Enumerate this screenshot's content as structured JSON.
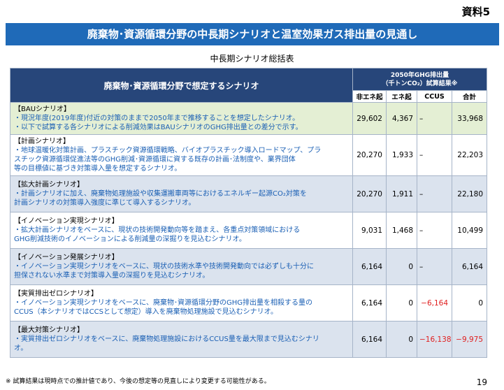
{
  "doc_label": "資料5",
  "title": "廃棄物･資源循環分野の中長期シナリオと温室効果ガス排出量の見通し",
  "subtitle": "中長期シナリオ総括表",
  "table": {
    "header_scenario": "廃棄物･資源循環分野で想定するシナリオ",
    "header_group_line1": "2050年GHG排出量",
    "header_group_line2": "（千トンCO₂）試算結果※",
    "columns": [
      "非エネ起",
      "エネ起",
      "CCUS",
      "合計"
    ],
    "rows": [
      {
        "name": "【BAUシナリオ】",
        "desc": [
          "・現況年度(2019年度)付近の対策のままで2050年まで推移することを想定したシナリオ。",
          "・以下で試算する各シナリオによる削減効果はBAUシナリオのGHG排出量との差分で示す。"
        ],
        "non_energy": "29,602",
        "energy": "4,367",
        "ccus": "–",
        "total": "33,968"
      },
      {
        "name": "【計画シナリオ】",
        "desc": [
          "・地球温暖化対策計画、プラスチック資源循環戦略、バイオプラスチック導入ロードマップ、プラ",
          "スチック資源循環促進法等のGHG削減･資源循環に資する既存の計画･法制度や、業界団体",
          "等の目標値に基づき対策導入量を想定するシナリオ。"
        ],
        "non_energy": "20,270",
        "energy": "1,933",
        "ccus": "–",
        "total": "22,203"
      },
      {
        "name": "【拡大計画シナリオ】",
        "desc": [
          "・計画シナリオに加え、廃棄物処理施設や収集運搬車両等におけるエネルギー起源CO₂対策を",
          "計画シナリオの対策導入強度に準じて導入するシナリオ。"
        ],
        "non_energy": "20,270",
        "energy": "1,911",
        "ccus": "–",
        "total": "22,180"
      },
      {
        "name": "【イノベーション実現シナリオ】",
        "desc": [
          "・拡大計画シナリオをベースに、現状の技術開発動向等を踏まえ、各重点対策領域における",
          "GHG削減技術のイノベーションによる削減量の深掘りを見込むシナリオ。"
        ],
        "non_energy": "9,031",
        "energy": "1,468",
        "ccus": "–",
        "total": "10,499"
      },
      {
        "name": "【イノベーション発展シナリオ】",
        "desc": [
          "・イノベーション実現シナリオをベースに、現状の技術水準や技術開発動向では必ずしも十分に",
          "担保されない水準まで対策導入量の深掘りを見込むシナリオ。"
        ],
        "non_energy": "6,164",
        "energy": "0",
        "ccus": "–",
        "total": "6,164"
      },
      {
        "name": "【実質排出ゼロシナリオ】",
        "desc": [
          "・イノベーション実現シナリオをベースに、廃棄物･資源循環分野のGHG排出量を相殺する量の",
          "CCUS（本シナリオではCCSとして想定）導入を廃棄物処理施設で見込むシナリオ。"
        ],
        "non_energy": "6,164",
        "energy": "0",
        "ccus": "−6,164",
        "total": "0"
      },
      {
        "name": "【最大対策シナリオ】",
        "desc": [
          "・実質排出ゼロシナリオをベースに、廃棄物処理施設におけるCCUS量を最大限まで見込むシナリ",
          "オ。"
        ],
        "non_energy": "6,164",
        "energy": "0",
        "ccus": "−16,138",
        "total": "−9,975"
      }
    ]
  },
  "note": "※ 試算結果は現時点での推計値であり、今後の想定等の見直しにより変更する可能性がある。",
  "page_number": "19",
  "colors": {
    "banner": "#1f6ab8",
    "header": "#27467a",
    "bau_row": "#e4efd4",
    "alt_row": "#dbe3ee",
    "desc_text": "#1a5fb4",
    "negative": "#e02020"
  }
}
